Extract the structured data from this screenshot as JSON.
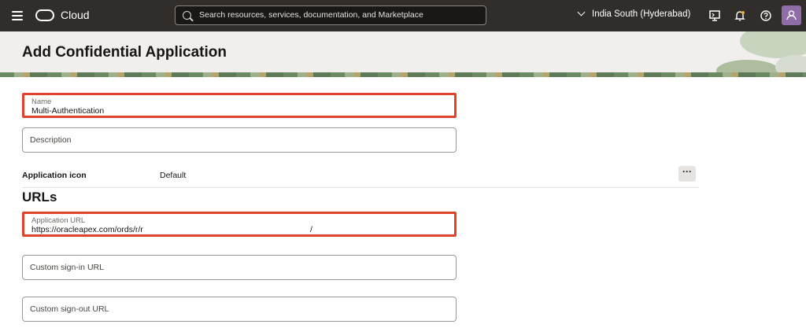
{
  "topbar": {
    "brand": "Cloud",
    "search_placeholder": "Search resources, services, documentation, and Marketplace",
    "region": "India South (Hyderabad)"
  },
  "header": {
    "title": "Add Confidential Application"
  },
  "form": {
    "name": {
      "label": "Name",
      "value": "Multi-Authentication"
    },
    "description": {
      "placeholder": "Description"
    },
    "app_icon": {
      "label": "Application icon",
      "value": "Default",
      "more": "···"
    },
    "urls_title": "URLs",
    "app_url": {
      "label": "Application URL",
      "value": "https://oracleapex.com/ords/r/r",
      "suffix": "/"
    },
    "signin": {
      "placeholder": "Custom sign-in URL"
    },
    "signout": {
      "placeholder": "Custom sign-out URL"
    }
  },
  "colors": {
    "topbar": "#312d2a",
    "highlight": "#e0432b",
    "banner": "#f1efed"
  }
}
